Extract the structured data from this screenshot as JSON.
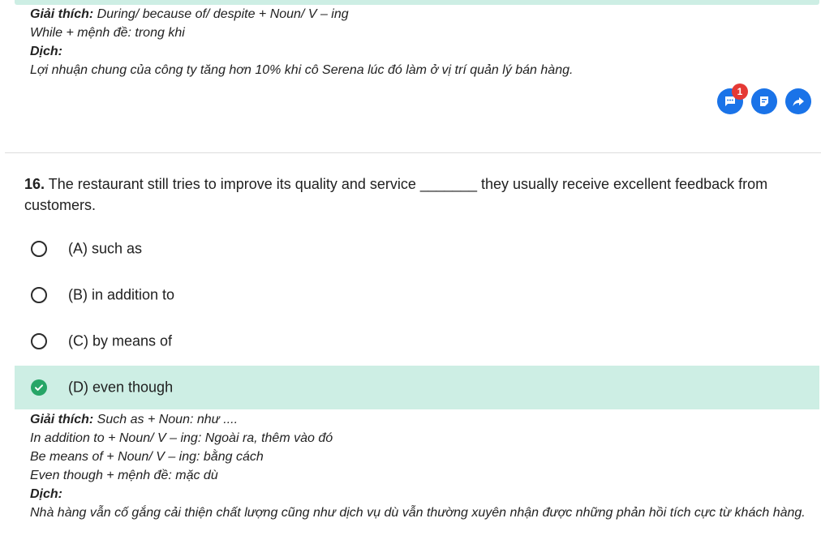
{
  "previous_explanation": {
    "explain_label": "Giải thích:",
    "explain_text": " During/ because of/ despite + Noun/ V – ing",
    "line2": "While + mệnh đề: trong khi",
    "translate_label": "Dịch:",
    "translation": "Lợi nhuận chung của công ty tăng hơn 10% khi cô Serena lúc đó làm ở vị trí quản lý bán hàng."
  },
  "actions": {
    "comment_badge": "1",
    "icons": [
      "comment-icon",
      "note-icon",
      "share-icon"
    ],
    "accent": "#1a73e8"
  },
  "question": {
    "number": "16.",
    "text": " The restaurant still tries to improve its quality and service _______ they usually receive excellent feedback from customers."
  },
  "options": [
    {
      "label": "(A) such as",
      "correct": false
    },
    {
      "label": "(B) in addition to",
      "correct": false
    },
    {
      "label": "(C) by means of",
      "correct": false
    },
    {
      "label": "(D) even though",
      "correct": true
    }
  ],
  "explanation": {
    "explain_label": "Giải thích:",
    "explain_text": " Such as + Noun: như ....",
    "line2": "In addition to + Noun/ V – ing: Ngoài ra, thêm vào đó",
    "line3": "Be means of + Noun/ V – ing: bằng cách",
    "line4": "Even though + mệnh đề: mặc dù",
    "translate_label": "Dịch:",
    "translation": "Nhà hàng vẫn cố gắng cải thiện chất lượng cũng như dịch vụ dù vẫn thường xuyên nhận được những phản hồi tích cực từ khách hàng."
  },
  "colors": {
    "correct_bg": "#cdeee4",
    "correct_check": "#27a567",
    "badge": "#e53935"
  }
}
